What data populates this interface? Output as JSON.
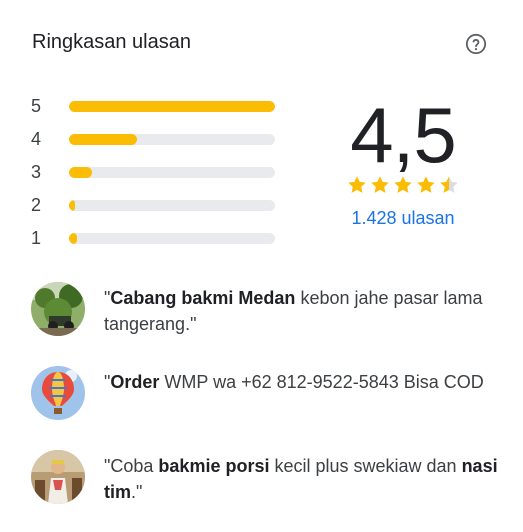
{
  "panel": {
    "title": "Ringkasan ulasan",
    "help_icon": "help-circle-icon"
  },
  "distribution": [
    {
      "label": "5",
      "fraction": 1.0
    },
    {
      "label": "4",
      "fraction": 0.33
    },
    {
      "label": "3",
      "fraction": 0.11
    },
    {
      "label": "2",
      "fraction": 0.02
    },
    {
      "label": "1",
      "fraction": 0.04
    }
  ],
  "summary": {
    "rating": "4,5",
    "stars": 4.5,
    "count_text": "1.428 ulasan"
  },
  "reviews": [
    {
      "avatar": "avatar-outdoor-plants",
      "parts": [
        {
          "text": "\"",
          "bold": false
        },
        {
          "text": "Cabang bakmi Medan",
          "bold": true
        },
        {
          "text": " kebon jahe pasar lama tangerang.\"",
          "bold": false
        }
      ]
    },
    {
      "avatar": "avatar-hot-air-balloon",
      "parts": [
        {
          "text": "\"",
          "bold": false
        },
        {
          "text": "Order",
          "bold": true
        },
        {
          "text": " WMP wa +62 812-9522-5843 Bisa COD",
          "bold": false
        }
      ]
    },
    {
      "avatar": "avatar-person-outdoors",
      "parts": [
        {
          "text": "\"Coba ",
          "bold": false
        },
        {
          "text": "bakmie porsi",
          "bold": true
        },
        {
          "text": " kecil plus swekiaw dan ",
          "bold": false
        },
        {
          "text": "nasi tim",
          "bold": true
        },
        {
          "text": ".\"",
          "bold": false
        }
      ]
    }
  ],
  "colors": {
    "bar_fill": "#fbbc04",
    "bar_track": "#e8eaed",
    "star_filled": "#fbbc04",
    "star_empty": "#dadce0",
    "link": "#1a73e8"
  }
}
